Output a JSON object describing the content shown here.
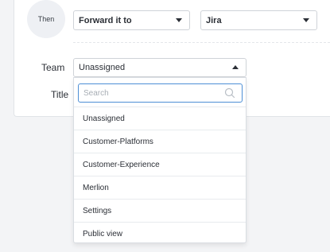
{
  "rule": {
    "then_label": "Then",
    "action": {
      "value": "Forward it to"
    },
    "target": {
      "value": "Jira"
    }
  },
  "fields": {
    "team": {
      "label": "Team",
      "value": "Unassigned",
      "search_placeholder": "Search",
      "options": [
        "Unassigned",
        "Customer-Platforms",
        "Customer-Experience",
        "Merlion",
        "Settings",
        "Public view"
      ]
    },
    "title": {
      "label": "Title"
    }
  },
  "colors": {
    "background": "#f3f4f6",
    "panel": "#ffffff",
    "focus_border": "#4d8fd6",
    "then_circle": "#eef0f4"
  },
  "icons": {
    "search": "search-icon",
    "caret_down": "caret-down-icon",
    "caret_up": "caret-up-icon"
  }
}
